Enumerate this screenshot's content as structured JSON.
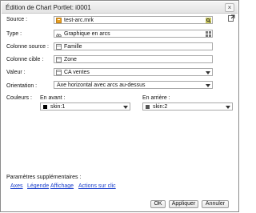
{
  "dialog": {
    "title": "Édition de Chart Portlet: i0001"
  },
  "form": {
    "source": {
      "label": "Source :",
      "value": "test-arc.mrk"
    },
    "type": {
      "label": "Type :",
      "value": "Graphique en arcs"
    },
    "colonne_source": {
      "label": "Colonne source :",
      "value": "Famille"
    },
    "colonne_cible": {
      "label": "Colonne cible :",
      "value": "Zone"
    },
    "valeur": {
      "label": "Valeur :",
      "value": "CA ventes"
    },
    "orientation": {
      "label": "Orientation :",
      "value": "Axe horizontal avec arcs au-dessus"
    },
    "couleurs": {
      "label": "Couleurs :",
      "en_avant": {
        "label": "En avant :",
        "value": "skin:1",
        "color": "#000000"
      },
      "en_arriere": {
        "label": "En arrière :",
        "value": "skin:2",
        "color": "#555555"
      }
    }
  },
  "extra": {
    "label": "Paramètres supplémentaires :",
    "links": [
      "Axes",
      "Légende",
      "Affichage",
      "Actions sur clic"
    ]
  },
  "buttons": {
    "ok": "OK",
    "apply": "Appliquer",
    "cancel": "Annuler"
  },
  "colors": {
    "link": "#1a3fcc",
    "icon_orange": "#e8a020"
  }
}
